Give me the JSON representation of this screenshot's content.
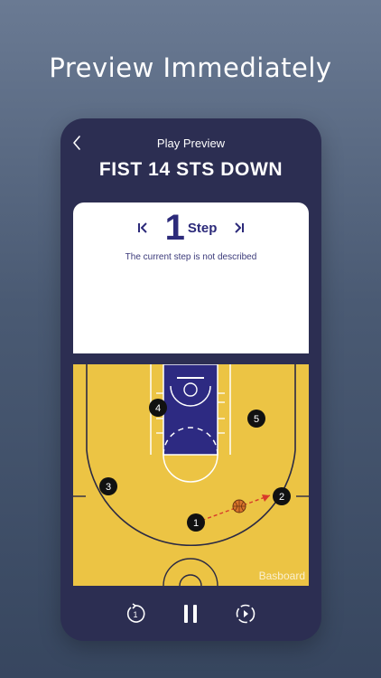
{
  "headline": "Preview Immediately",
  "nav": {
    "title": "Play Preview"
  },
  "play": {
    "name": "FIST 14 STS DOWN"
  },
  "step": {
    "number": "1",
    "word": "Step",
    "description": "The current step is not described"
  },
  "court": {
    "watermark": "Basboard",
    "floor_color": "#ecc444",
    "paint_color": "#2d2a82",
    "players": [
      {
        "label": "1"
      },
      {
        "label": "2"
      },
      {
        "label": "3"
      },
      {
        "label": "4"
      },
      {
        "label": "5"
      }
    ]
  },
  "controls": {
    "restart_icon": "replay-icon",
    "pause_icon": "pause-icon",
    "next_icon": "next-step-icon"
  },
  "colors": {
    "background_top": "#6a7a93",
    "background_bottom": "#37465f",
    "panel": "#2c2e52",
    "accent": "#2c2a7a",
    "pass_arrow": "#d83a2a"
  }
}
